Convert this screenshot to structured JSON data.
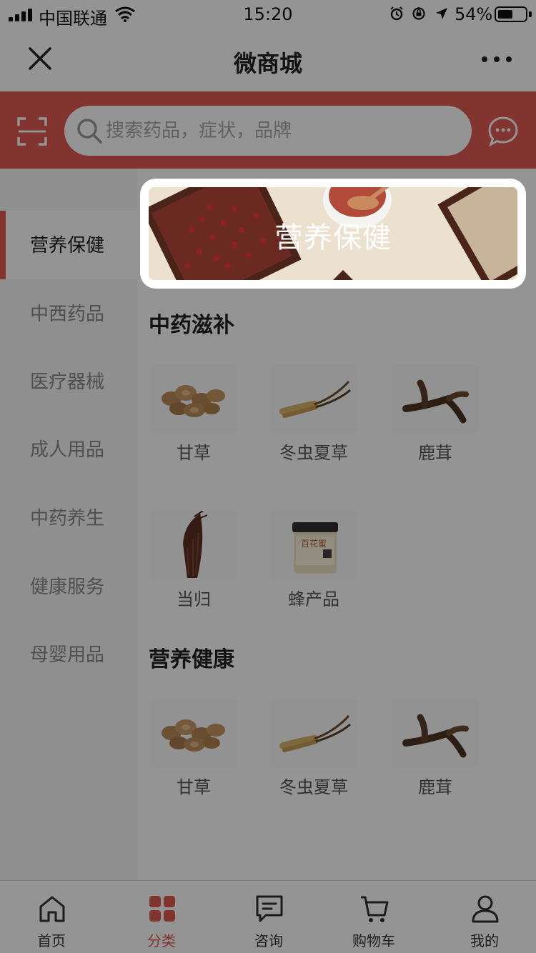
{
  "status_bar": {
    "carrier": "中国联通",
    "time": "15:20",
    "battery": "54%"
  },
  "nav": {
    "title": "微商城"
  },
  "search": {
    "placeholder": "搜索药品，症状，品牌"
  },
  "sidebar": {
    "items": [
      {
        "label": "营养保健",
        "active": true
      },
      {
        "label": "中西药品"
      },
      {
        "label": "医疗器械"
      },
      {
        "label": "成人用品"
      },
      {
        "label": "中药养生"
      },
      {
        "label": "健康服务"
      },
      {
        "label": "母婴用品"
      }
    ]
  },
  "banner": {
    "title": "营养保健"
  },
  "sections": [
    {
      "title": "中药滋补",
      "products": [
        "甘草",
        "冬虫夏草",
        "鹿茸",
        "当归",
        "蜂产品"
      ]
    },
    {
      "title": "营养健康",
      "products": [
        "甘草",
        "冬虫夏草",
        "鹿茸"
      ]
    }
  ],
  "honey_jar_label": "百花蜜",
  "tab_bar": {
    "tabs": [
      {
        "label": "首页",
        "icon": "home-icon"
      },
      {
        "label": "分类",
        "icon": "category-icon",
        "active": true
      },
      {
        "label": "咨询",
        "icon": "consult-icon"
      },
      {
        "label": "购物车",
        "icon": "cart-icon"
      },
      {
        "label": "我的",
        "icon": "profile-icon"
      }
    ]
  },
  "colors": {
    "accent": "#e05a55",
    "overlay": "rgba(0,0,0,0.42)"
  }
}
